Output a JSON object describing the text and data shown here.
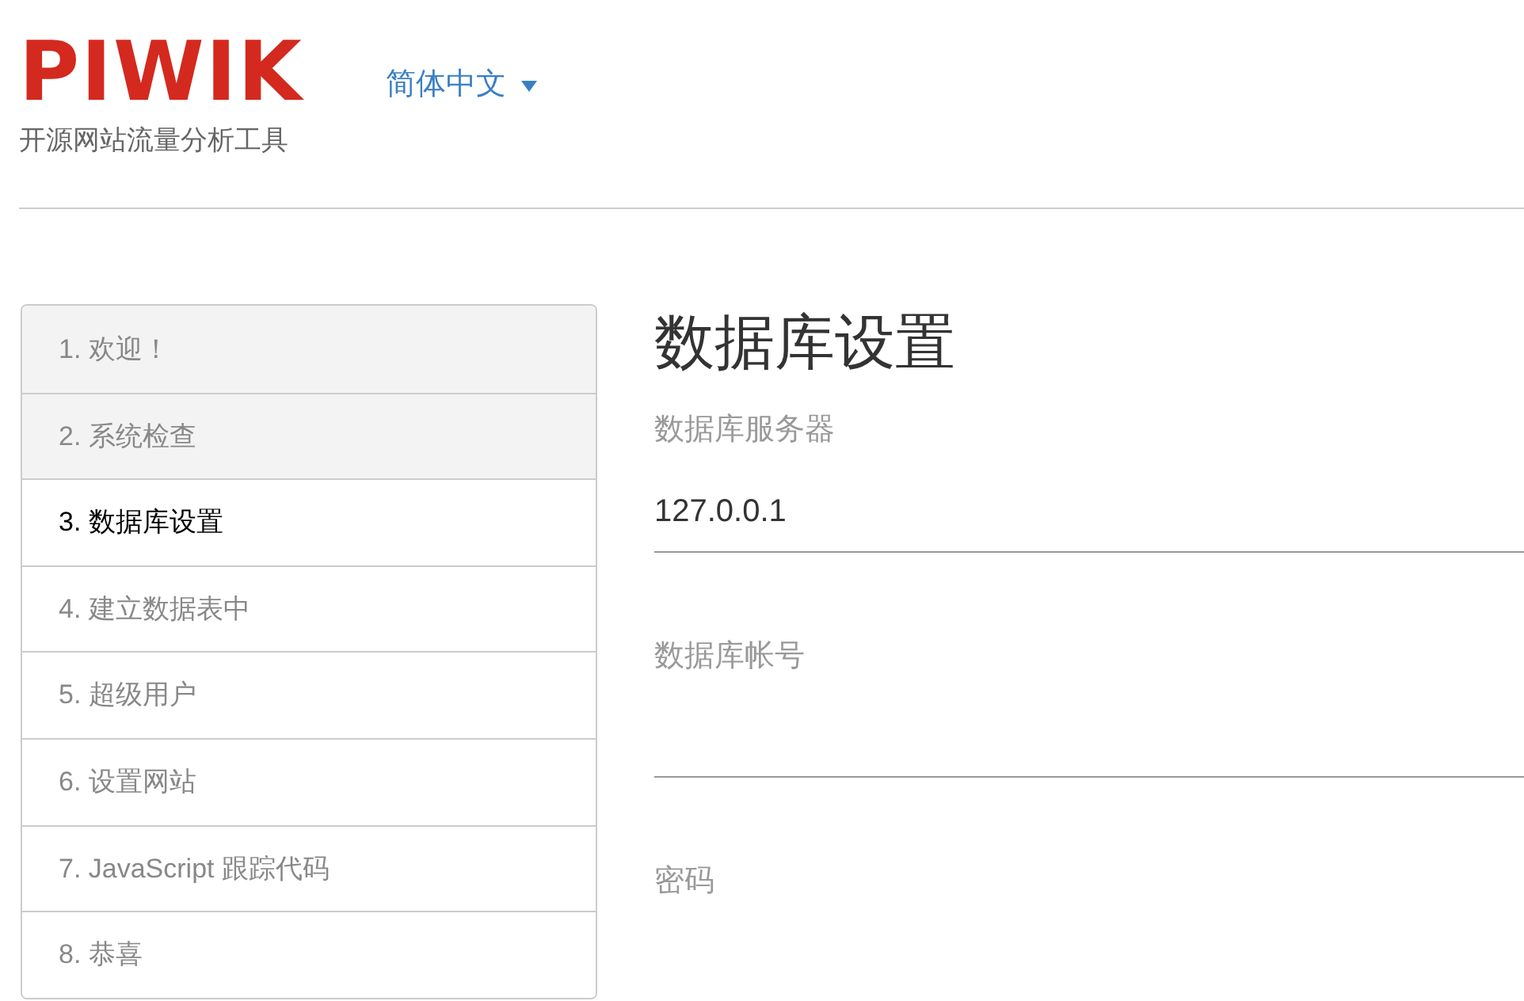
{
  "header": {
    "logo": "PIWIK",
    "tagline": "开源网站流量分析工具",
    "language": "简体中文"
  },
  "steps": [
    {
      "label": "1. 欢迎！",
      "completed": true,
      "selected": false
    },
    {
      "label": "2. 系统检查",
      "completed": true,
      "selected": false
    },
    {
      "label": "3. 数据库设置",
      "completed": false,
      "selected": true
    },
    {
      "label": "4. 建立数据表中",
      "completed": false,
      "selected": false
    },
    {
      "label": "5. 超级用户",
      "completed": false,
      "selected": false
    },
    {
      "label": "6. 设置网站",
      "completed": false,
      "selected": false
    },
    {
      "label": "7. JavaScript 跟踪代码",
      "completed": false,
      "selected": false
    },
    {
      "label": "8. 恭喜",
      "completed": false,
      "selected": false
    }
  ],
  "form": {
    "title": "数据库设置",
    "fields": [
      {
        "kind": "input",
        "label": "数据库服务器",
        "value": "127.0.0.1"
      },
      {
        "kind": "input",
        "label": "数据库帐号"
      },
      {
        "kind": "label",
        "label": "密码"
      }
    ]
  }
}
